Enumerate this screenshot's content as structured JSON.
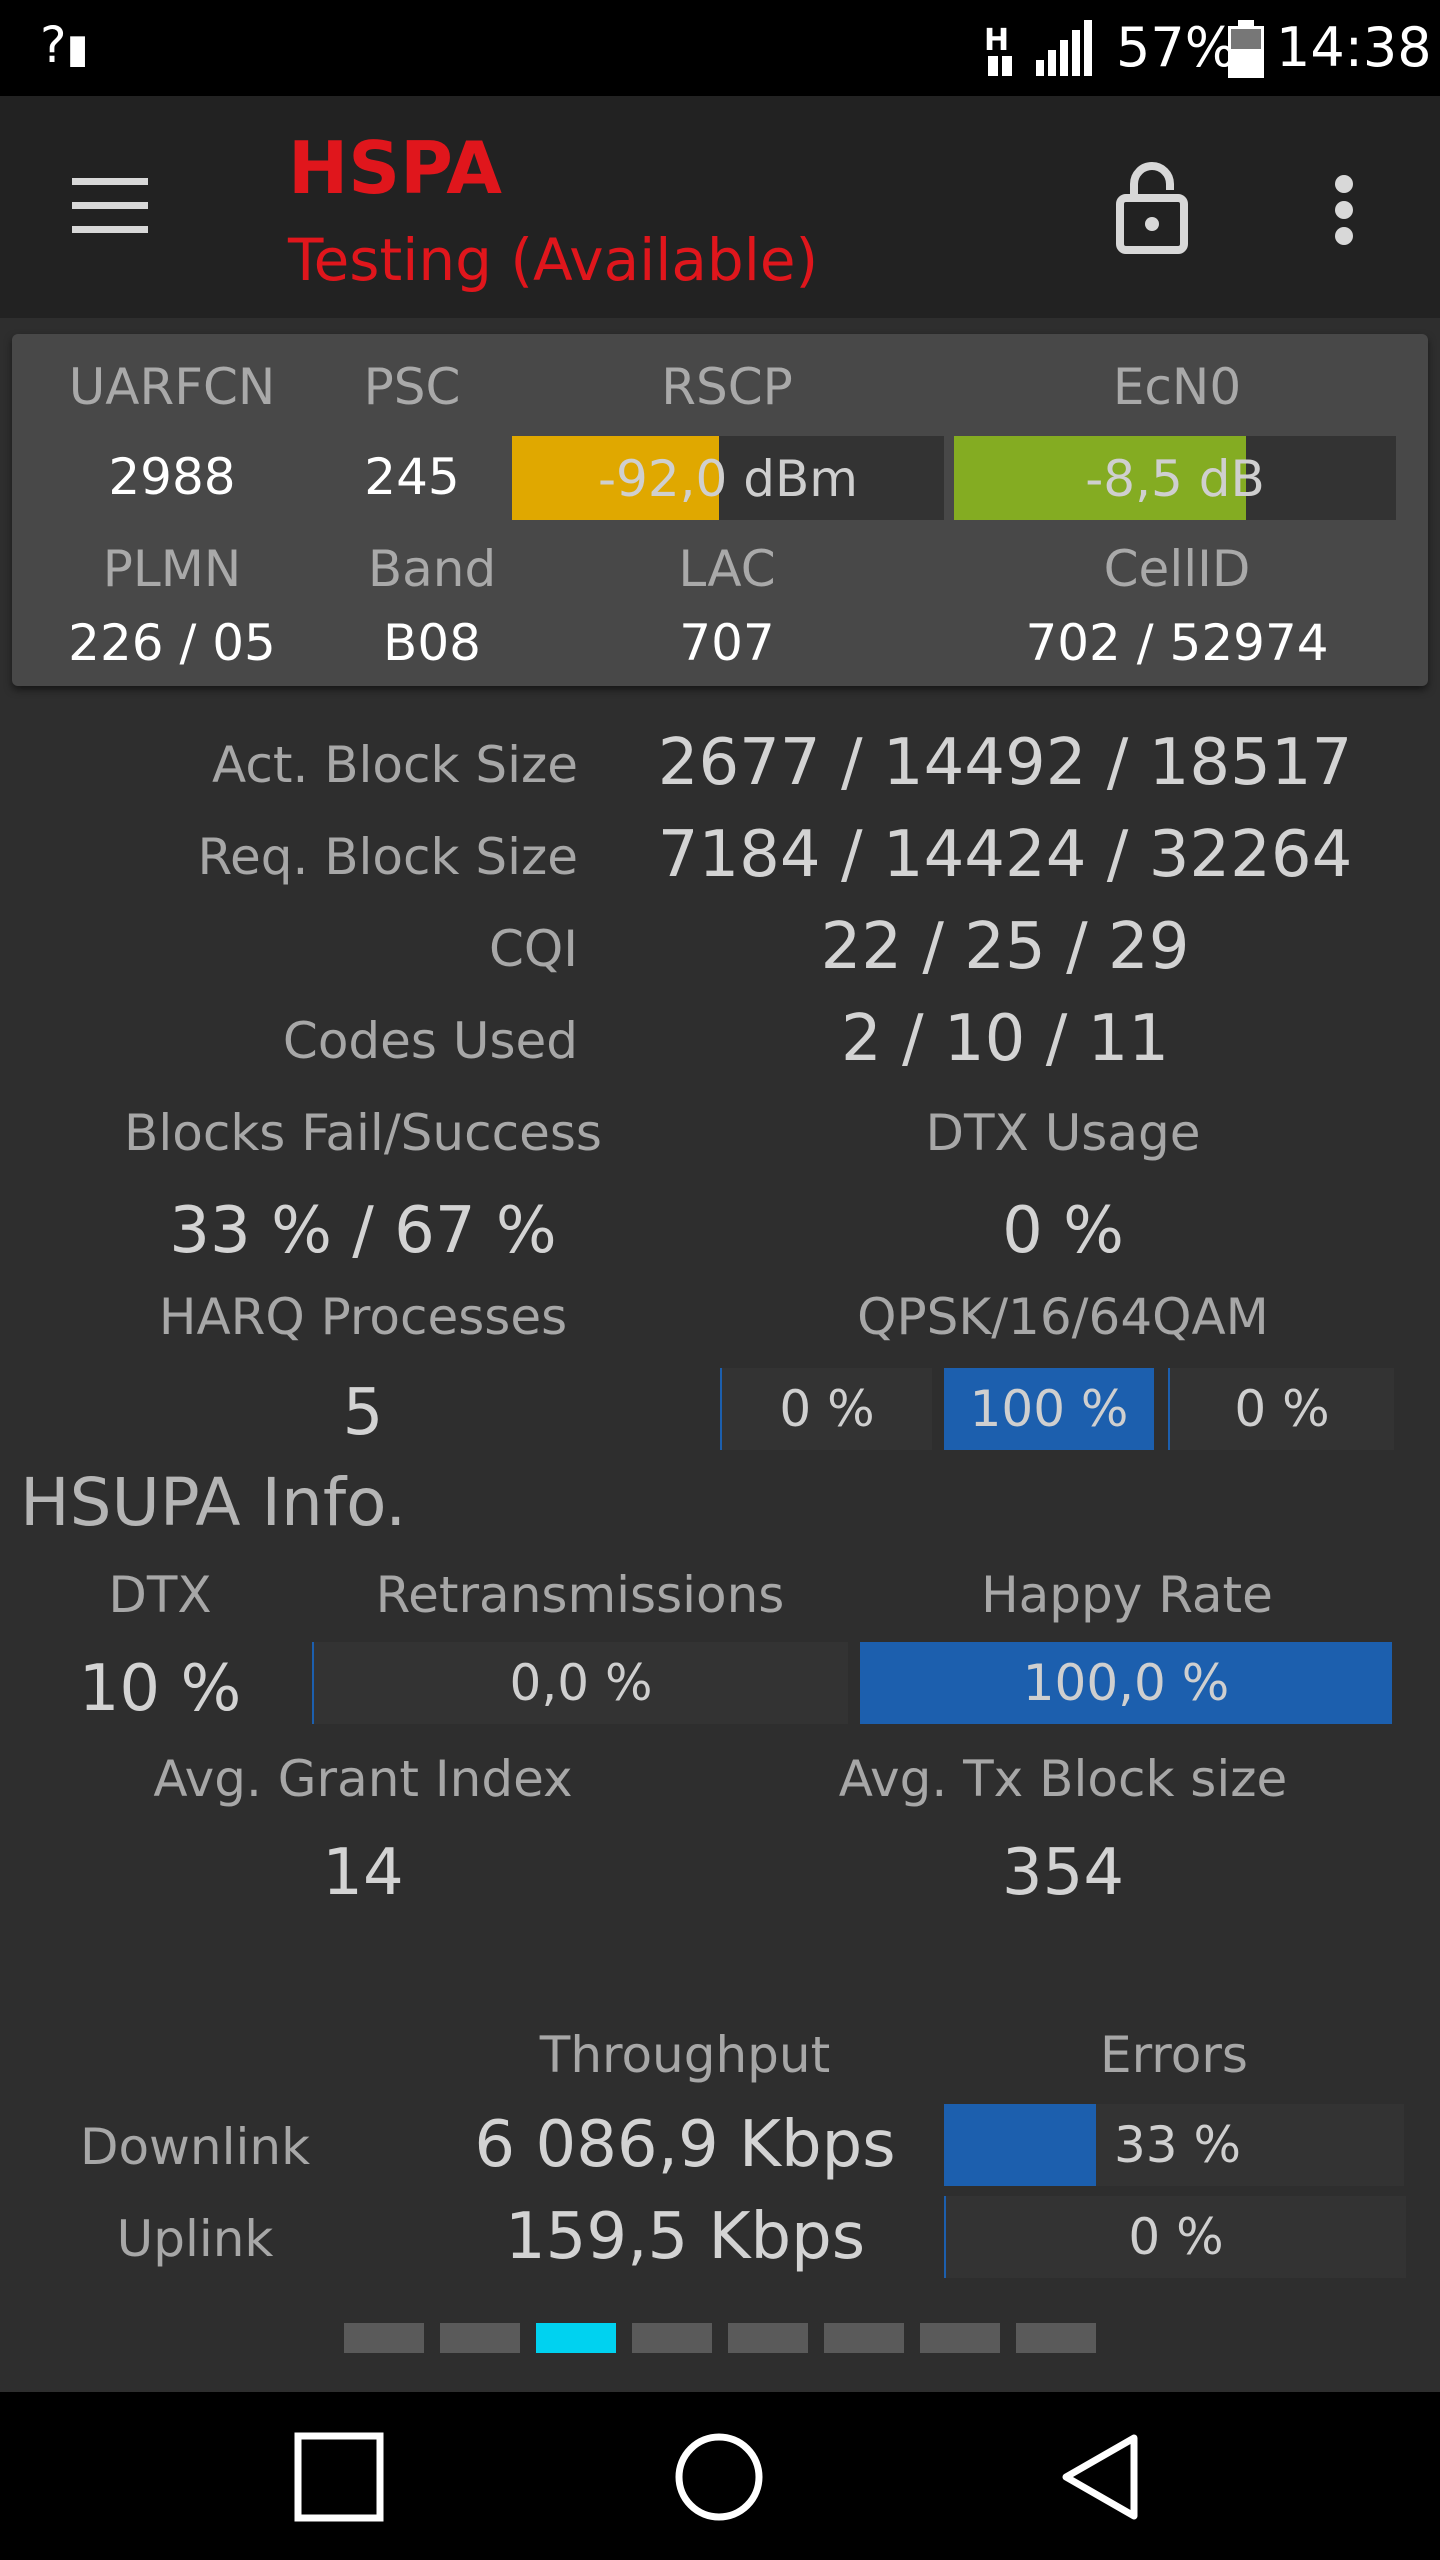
{
  "status_bar": {
    "left_icon": "signal-unknown-icon",
    "battery_pct": "57%",
    "time": "14:38"
  },
  "app_bar": {
    "title": "HSPA",
    "subtitle": "Testing (Available)"
  },
  "panel": {
    "labels": {
      "uarfcn": "UARFCN",
      "psc": "PSC",
      "rscp": "RSCP",
      "ecn0": "EcN0",
      "plmn": "PLMN",
      "band": "Band",
      "lac": "LAC",
      "cellid": "CellID"
    },
    "values": {
      "uarfcn": "2988",
      "psc": "245",
      "rscp": "-92,0 dBm",
      "ecn0": "-8,5 dB",
      "plmn": "226 / 05",
      "band": "B08",
      "lac": "707",
      "cellid": "702 / 52974"
    },
    "colors": {
      "rscp": "#e0a800",
      "ecn0": "#84ac22"
    },
    "rscp_fill": 0.48,
    "ecn0_fill": 0.66
  },
  "hsdpa": {
    "act_block_label": "Act. Block Size",
    "act_block": "2677 / 14492 / 18517",
    "req_block_label": "Req. Block Size",
    "req_block": "7184 / 14424 / 32264",
    "cqi_label": "CQI",
    "cqi": "22 / 25 / 29",
    "codes_label": "Codes Used",
    "codes": "2 / 10 / 11",
    "blocks_label": "Blocks Fail/Success",
    "blocks": "33 % / 67 %",
    "dtx_label": "DTX Usage",
    "dtx": "0 %",
    "harq_label": "HARQ Processes",
    "harq": "5",
    "mod_label": "QPSK/16/64QAM",
    "qpsk": "0 %",
    "qam16": "100 %",
    "qam64": "0 %",
    "mod_fill": {
      "qpsk": 0,
      "qam16": 1.0,
      "qam64": 0
    }
  },
  "hsupa": {
    "section_title": "HSUPA Info.",
    "dtx_label": "DTX",
    "dtx": "10 %",
    "retrans_label": "Retransmissions",
    "retrans": "0,0 %",
    "retrans_fill": 0,
    "happy_label": "Happy Rate",
    "happy": "100,0 %",
    "happy_fill": 1.0,
    "grant_label": "Avg. Grant Index",
    "grant": "14",
    "txblock_label": "Avg. Tx Block size",
    "txblock": "354"
  },
  "throughput": {
    "throughput_label": "Throughput",
    "errors_label": "Errors",
    "downlink_label": "Downlink",
    "downlink": "6 086,9 Kbps",
    "downlink_err": "33 %",
    "downlink_err_fill": 0.33,
    "uplink_label": "Uplink",
    "uplink": "159,5 Kbps",
    "uplink_err": "0 %",
    "uplink_err_fill": 0
  },
  "accent": "#1c5fae",
  "pager": {
    "count": 8,
    "active": 3
  }
}
